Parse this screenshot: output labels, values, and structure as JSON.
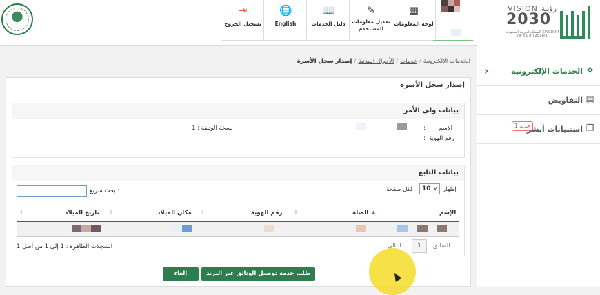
{
  "header": {
    "nav": [
      {
        "id": "logout",
        "label": "تسجيل الخروج",
        "icon": "logout-icon",
        "glyph": "⇥"
      },
      {
        "id": "english",
        "label": "English",
        "icon": "globe-icon",
        "glyph": "🌐"
      },
      {
        "id": "guide",
        "label": "دليل الخدمات",
        "icon": "book-icon",
        "glyph": "📖"
      },
      {
        "id": "edit-user",
        "label": "تعديل معلومات المستخدم",
        "icon": "edit-icon",
        "glyph": "✎"
      },
      {
        "id": "dashboard",
        "label": "لوحة المعلومات",
        "icon": "dashboard-icon",
        "glyph": "▦"
      }
    ],
    "vision": {
      "line1": "VISION رؤيـة",
      "line2": "2030",
      "line3": "المملكة العربية السعودية KINGDOM OF SAUDI ARABIA"
    },
    "colors": {
      "accent": "#2e7d4f",
      "logout_icon": "#e8603c"
    }
  },
  "sidebar": {
    "items": [
      {
        "label": "الخدمات الإلكترونية",
        "icon": "services-icon",
        "glyph": "❖",
        "active": true
      },
      {
        "label": "التفاويض",
        "icon": "briefcase-icon",
        "glyph": "▤",
        "active": false
      },
      {
        "label": "استبيانات أبشر",
        "icon": "clipboard-icon",
        "glyph": "❐",
        "active": false,
        "badge": "جديد 1"
      }
    ]
  },
  "breadcrumb": {
    "items": [
      "الخدمات الإلكترونية",
      "خدمات",
      "الأحوال المدنية"
    ],
    "current": "إصدار سجل الأسرة",
    "separator": "/"
  },
  "main": {
    "title": "إصدار سجل الأسرة",
    "guardian": {
      "title": "بيانات ولي الأمر",
      "name_label": "الإسم",
      "id_label": "رقم الهوية",
      "colon": ":",
      "copy_label": "نسخة الوثيقة : 1"
    },
    "dependents": {
      "title": "بيانات التابع",
      "show_label": "إظهار",
      "page_size": "10",
      "per_page_label": "لكل صفحة",
      "search_label": "بحث سريع :",
      "search_value": "",
      "columns": [
        "الإسم",
        "الصلة",
        "رقم الهوية",
        "مكان الميلاد",
        "تاريخ الميلاد"
      ],
      "prev_label": "السابق",
      "page": "1",
      "next_label": "التالي",
      "info": "السجلات الظاهرة : 1 إلى 1 من أصل 1"
    },
    "actions": {
      "deliver": "طلب خدمة توصيل الوثائق عبر البريد",
      "cancel": "إلغاء"
    }
  }
}
